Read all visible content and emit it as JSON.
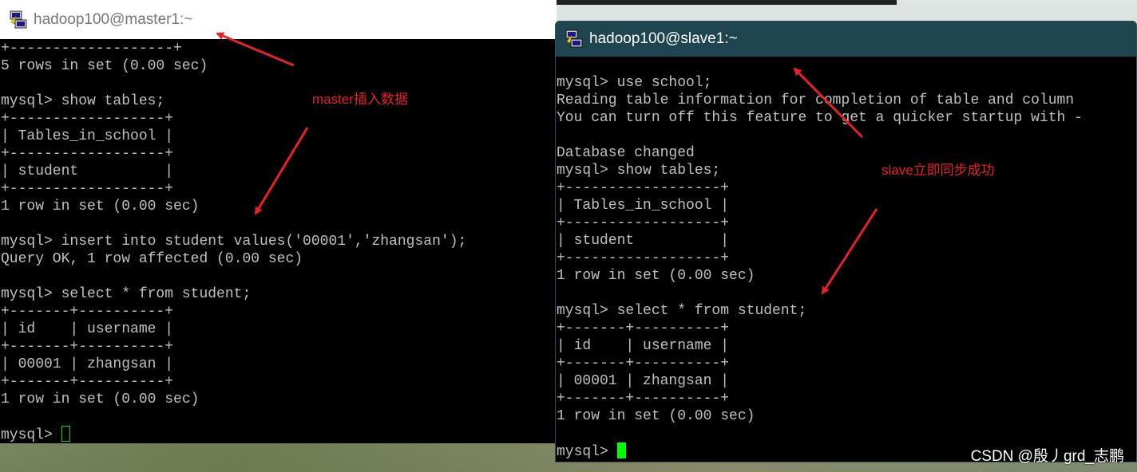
{
  "windows": {
    "master": {
      "title": "hadoop100@master1:~",
      "lines": [
        "+-------------------+",
        "5 rows in set (0.00 sec)",
        "",
        "mysql> show tables;",
        "+------------------+",
        "| Tables_in_school |",
        "+------------------+",
        "| student          |",
        "+------------------+",
        "1 row in set (0.00 sec)",
        "",
        "mysql> insert into student values('00001','zhangsan');",
        "Query OK, 1 row affected (0.00 sec)",
        "",
        "mysql> select * from student;",
        "+-------+----------+",
        "| id    | username |",
        "+-------+----------+",
        "| 00001 | zhangsan |",
        "+-------+----------+",
        "1 row in set (0.00 sec)",
        ""
      ],
      "prompt": "mysql> "
    },
    "slave": {
      "title": "hadoop100@slave1:~",
      "lines": [
        "mysql> use school;",
        "Reading table information for completion of table and column",
        "You can turn off this feature to get a quicker startup with -",
        "",
        "Database changed",
        "mysql> show tables;",
        "+------------------+",
        "| Tables_in_school |",
        "+------------------+",
        "| student          |",
        "+------------------+",
        "1 row in set (0.00 sec)",
        "",
        "mysql> select * from student;",
        "+-------+----------+",
        "| id    | username |",
        "+-------+----------+",
        "| 00001 | zhangsan |",
        "+-------+----------+",
        "1 row in set (0.00 sec)",
        ""
      ],
      "prompt": "mysql> "
    }
  },
  "annotations": {
    "master_note": "master插入数据",
    "slave_note": "slave立即同步成功"
  },
  "watermark": "CSDN @殷丿grd_志鹏",
  "colors": {
    "annotation": "#e8202a",
    "cursor": "#00ff00",
    "slave_titlebar": "#1f4550"
  },
  "icons": {
    "window_icon": "putty-icon"
  }
}
